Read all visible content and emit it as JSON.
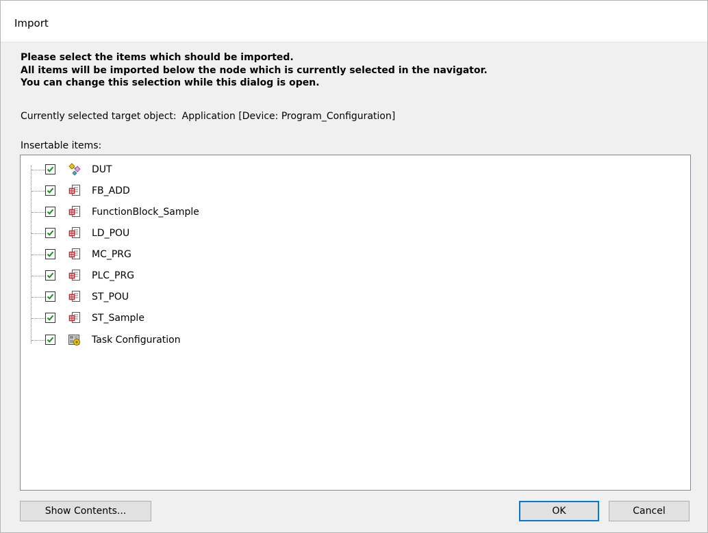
{
  "window": {
    "title": "Import"
  },
  "intro": {
    "line1": "Please select the items which should be imported.",
    "line2": "All items will be imported below the node which is currently selected in the navigator.",
    "line3": "You can change this selection while this dialog is open."
  },
  "target": {
    "label": "Currently selected target object:",
    "value": "Application [Device: Program_Configuration]"
  },
  "tree": {
    "label": "Insertable items:",
    "items": [
      {
        "label": "DUT",
        "checked": true,
        "icon": "dut-icon"
      },
      {
        "label": "FB_ADD",
        "checked": true,
        "icon": "pou-icon"
      },
      {
        "label": "FunctionBlock_Sample",
        "checked": true,
        "icon": "pou-icon"
      },
      {
        "label": "LD_POU",
        "checked": true,
        "icon": "pou-icon"
      },
      {
        "label": "MC_PRG",
        "checked": true,
        "icon": "pou-icon"
      },
      {
        "label": "PLC_PRG",
        "checked": true,
        "icon": "pou-icon"
      },
      {
        "label": "ST_POU",
        "checked": true,
        "icon": "pou-icon"
      },
      {
        "label": "ST_Sample",
        "checked": true,
        "icon": "pou-icon"
      },
      {
        "label": "Task Configuration",
        "checked": true,
        "icon": "task-configuration-icon"
      }
    ]
  },
  "buttons": {
    "show_contents": "Show Contents...",
    "ok": "OK",
    "cancel": "Cancel"
  },
  "colors": {
    "accent": "#0078d7",
    "check": "#1a8f1a"
  }
}
